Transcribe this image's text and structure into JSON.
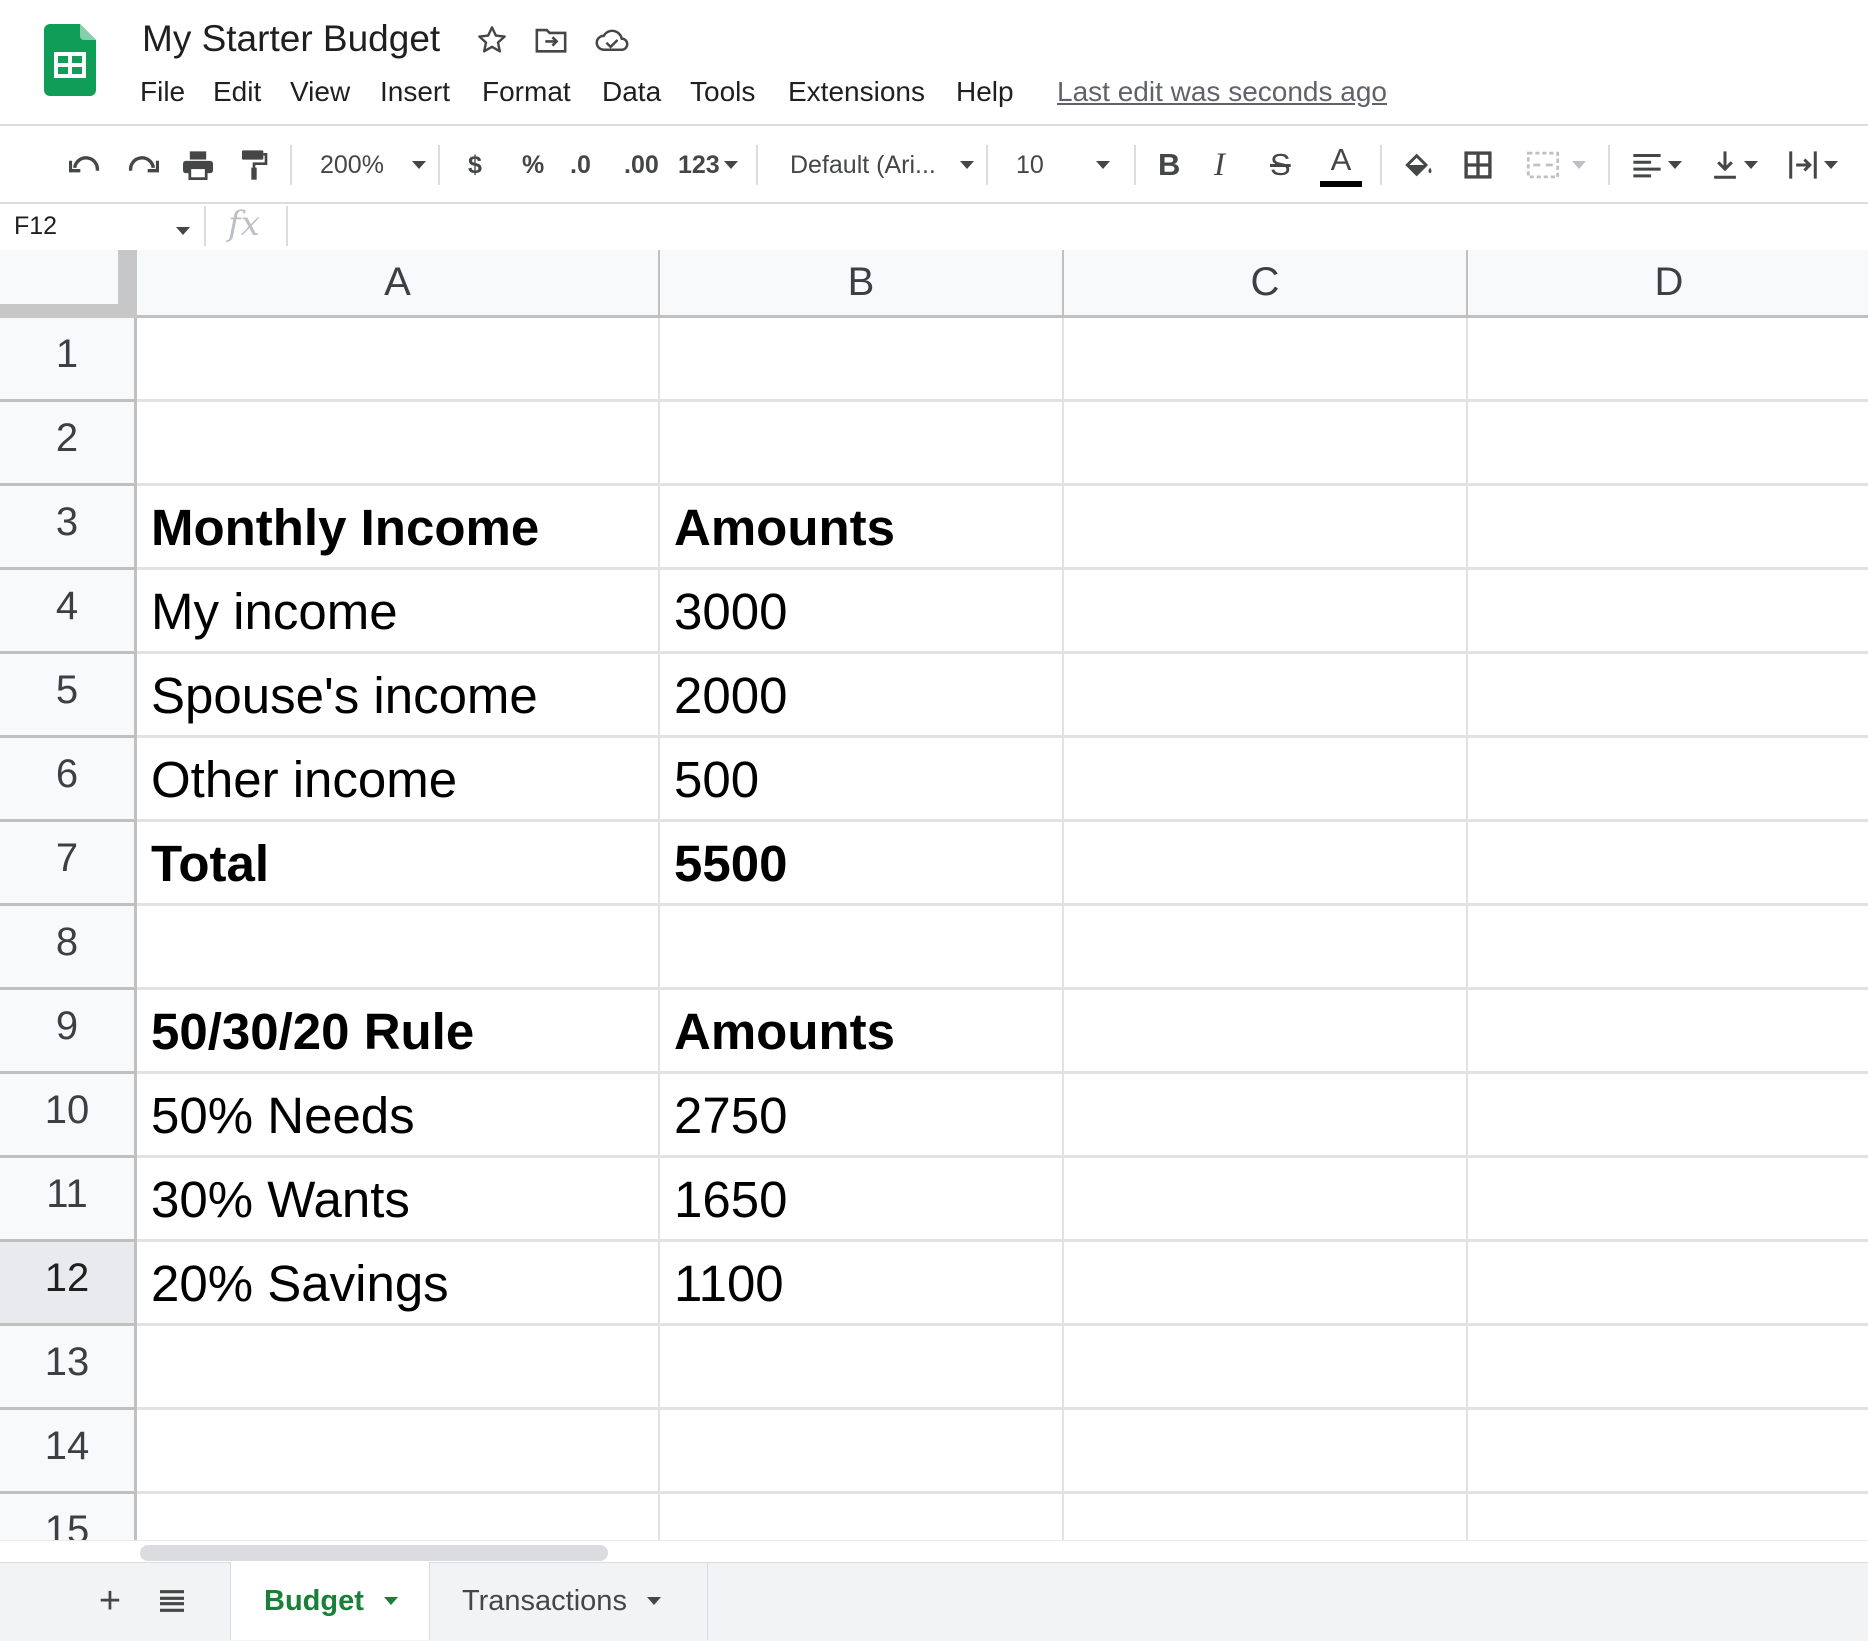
{
  "app": {
    "document_title": "My Starter Budget",
    "menu": [
      "File",
      "Edit",
      "View",
      "Insert",
      "Format",
      "Data",
      "Tools",
      "Extensions",
      "Help"
    ],
    "last_edit": "Last edit was seconds ago"
  },
  "toolbar": {
    "zoom": "200%",
    "currency": "$",
    "percent": "%",
    "decrease_decimals": ".0",
    "increase_decimals": ".00",
    "more_formats": "123",
    "font_family": "Default (Ari...",
    "font_size": "10",
    "bold": "B",
    "italic": "I",
    "strikethrough": "S",
    "text_color": "A"
  },
  "formula_bar": {
    "name_box": "F12",
    "fx": "fx",
    "formula": ""
  },
  "sheet": {
    "columns": [
      "A",
      "B",
      "C",
      "D"
    ],
    "rows": [
      {
        "n": "1",
        "a": "",
        "b": "",
        "bold": false
      },
      {
        "n": "2",
        "a": "",
        "b": "",
        "bold": false
      },
      {
        "n": "3",
        "a": "Monthly Income",
        "b": "Amounts",
        "bold": true
      },
      {
        "n": "4",
        "a": "My income",
        "b": "3000",
        "bold": false
      },
      {
        "n": "5",
        "a": "Spouse's income",
        "b": "2000",
        "bold": false
      },
      {
        "n": "6",
        "a": "Other income",
        "b": "500",
        "bold": false
      },
      {
        "n": "7",
        "a": "Total",
        "b": "5500",
        "bold": true
      },
      {
        "n": "8",
        "a": "",
        "b": "",
        "bold": false
      },
      {
        "n": "9",
        "a": "50/30/20 Rule",
        "b": "Amounts",
        "bold": true
      },
      {
        "n": "10",
        "a": "50% Needs",
        "b": "2750",
        "bold": false
      },
      {
        "n": "11",
        "a": "30% Wants",
        "b": "1650",
        "bold": false
      },
      {
        "n": "12",
        "a": "20% Savings",
        "b": "1100",
        "bold": false
      },
      {
        "n": "13",
        "a": "",
        "b": "",
        "bold": false
      },
      {
        "n": "14",
        "a": "",
        "b": "",
        "bold": false
      },
      {
        "n": "15",
        "a": "",
        "b": "",
        "bold": false
      }
    ],
    "selected_row": "12"
  },
  "tabs": {
    "sheets": [
      "Budget",
      "Transactions"
    ],
    "active": "Budget",
    "add_icon": "+",
    "list_icon": "≣"
  },
  "colors": {
    "sheets_green": "#0f9d58",
    "active_tab_text": "#188038",
    "grid_line": "#e2e2e2",
    "header_bg": "#f8f9fa"
  }
}
